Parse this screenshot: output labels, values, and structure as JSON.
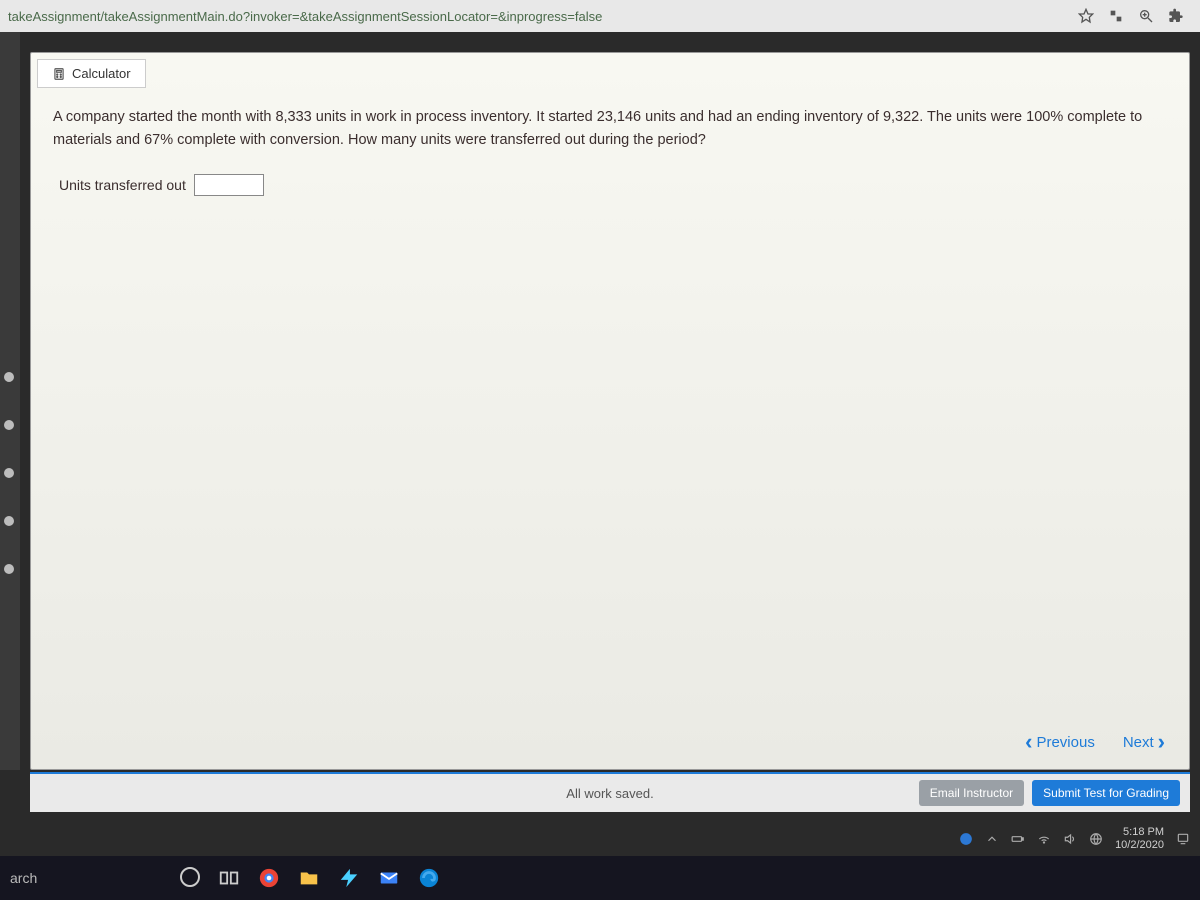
{
  "browser": {
    "url": "takeAssignment/takeAssignmentMain.do?invoker=&takeAssignmentSessionLocator=&inprogress=false"
  },
  "tab": {
    "calculator": "Calculator"
  },
  "question": {
    "text": "A company started the month with 8,333 units in work in process inventory. It started 23,146 units and had an ending inventory of 9,322. The units were 100% complete to materials and 67% complete with conversion. How many units were transferred out during the period?",
    "answer_label": "Units transferred out",
    "answer_value": ""
  },
  "nav": {
    "previous": "Previous",
    "next": "Next"
  },
  "footer": {
    "saved": "All work saved.",
    "email": "Email Instructor",
    "submit": "Submit Test for Grading"
  },
  "system": {
    "time": "5:18 PM",
    "date": "10/2/2020"
  },
  "taskbar": {
    "search": "arch"
  }
}
